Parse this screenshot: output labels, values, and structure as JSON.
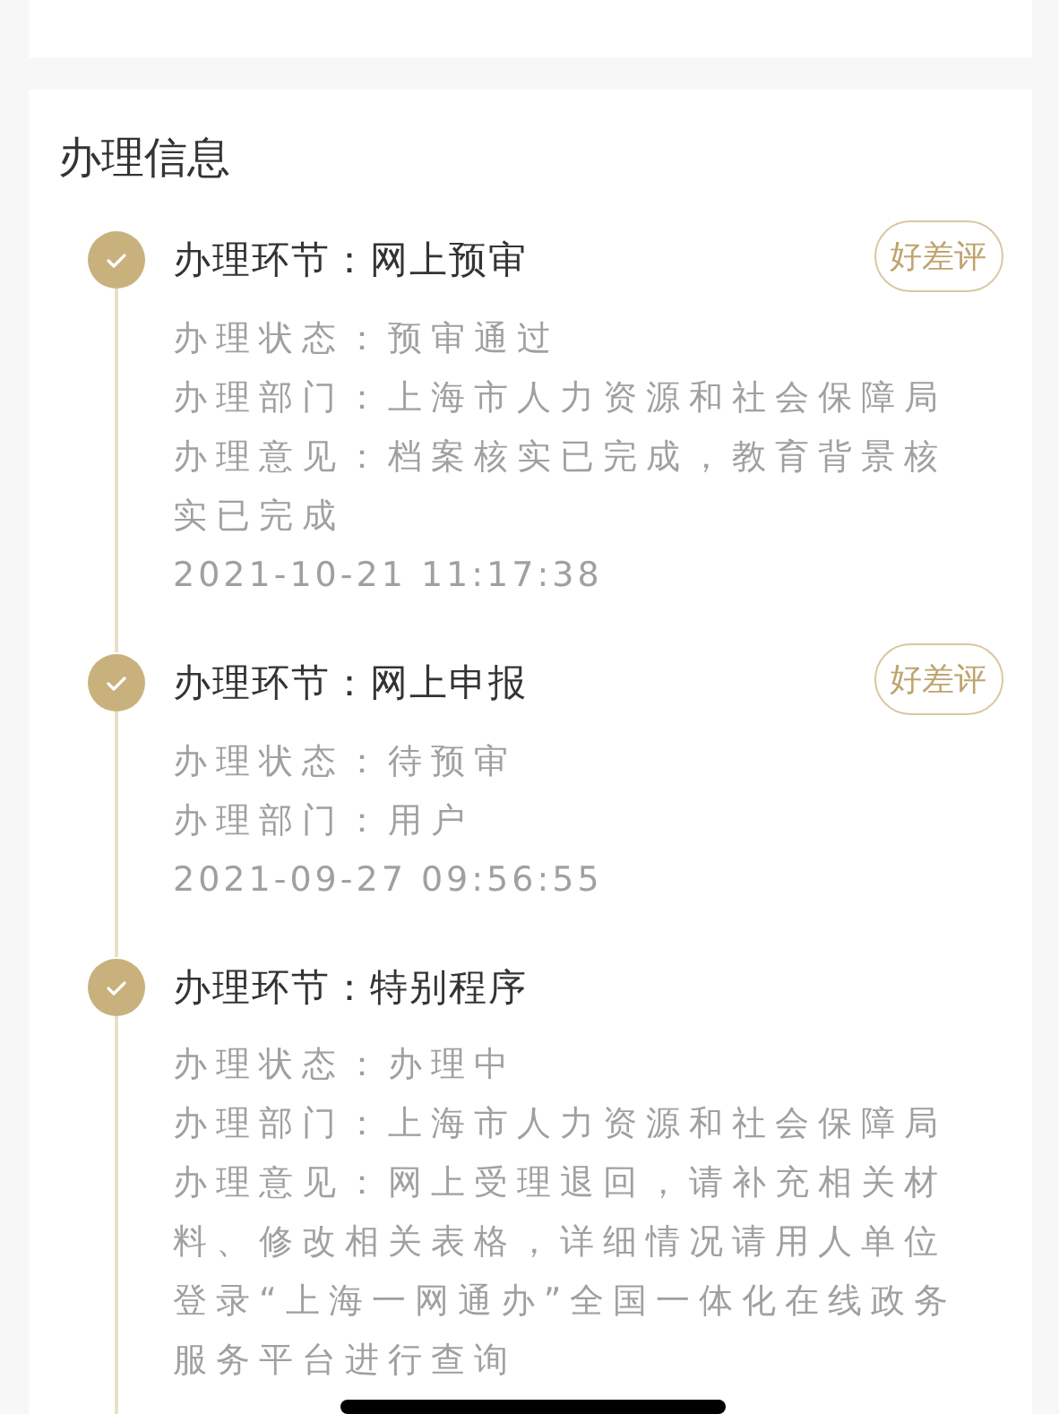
{
  "section": {
    "title": "办理信息"
  },
  "steps": [
    {
      "title": "办理环节：网上预审",
      "rating_button": "好差评",
      "lines": [
        "办理状态：预审通过",
        "办理部门：上海市人力资源和社会保障局",
        "办理意见：档案核实已完成，教育背景核实已完成"
      ],
      "time": "2021-10-21 11:17:38"
    },
    {
      "title": "办理环节：网上申报",
      "rating_button": "好差评",
      "lines": [
        "办理状态：待预审",
        "办理部门：用户"
      ],
      "time": "2021-09-27 09:56:55"
    },
    {
      "title": "办理环节：特别程序",
      "lines": [
        "办理状态：办理中",
        "办理部门：上海市人力资源和社会保障局",
        "办理意见：网上受理退回，请补充相关材料、修改相关表格，详细情况请用人单位登录“上海一网通办”全国一体化在线政务服务平台进行查询"
      ]
    }
  ]
}
